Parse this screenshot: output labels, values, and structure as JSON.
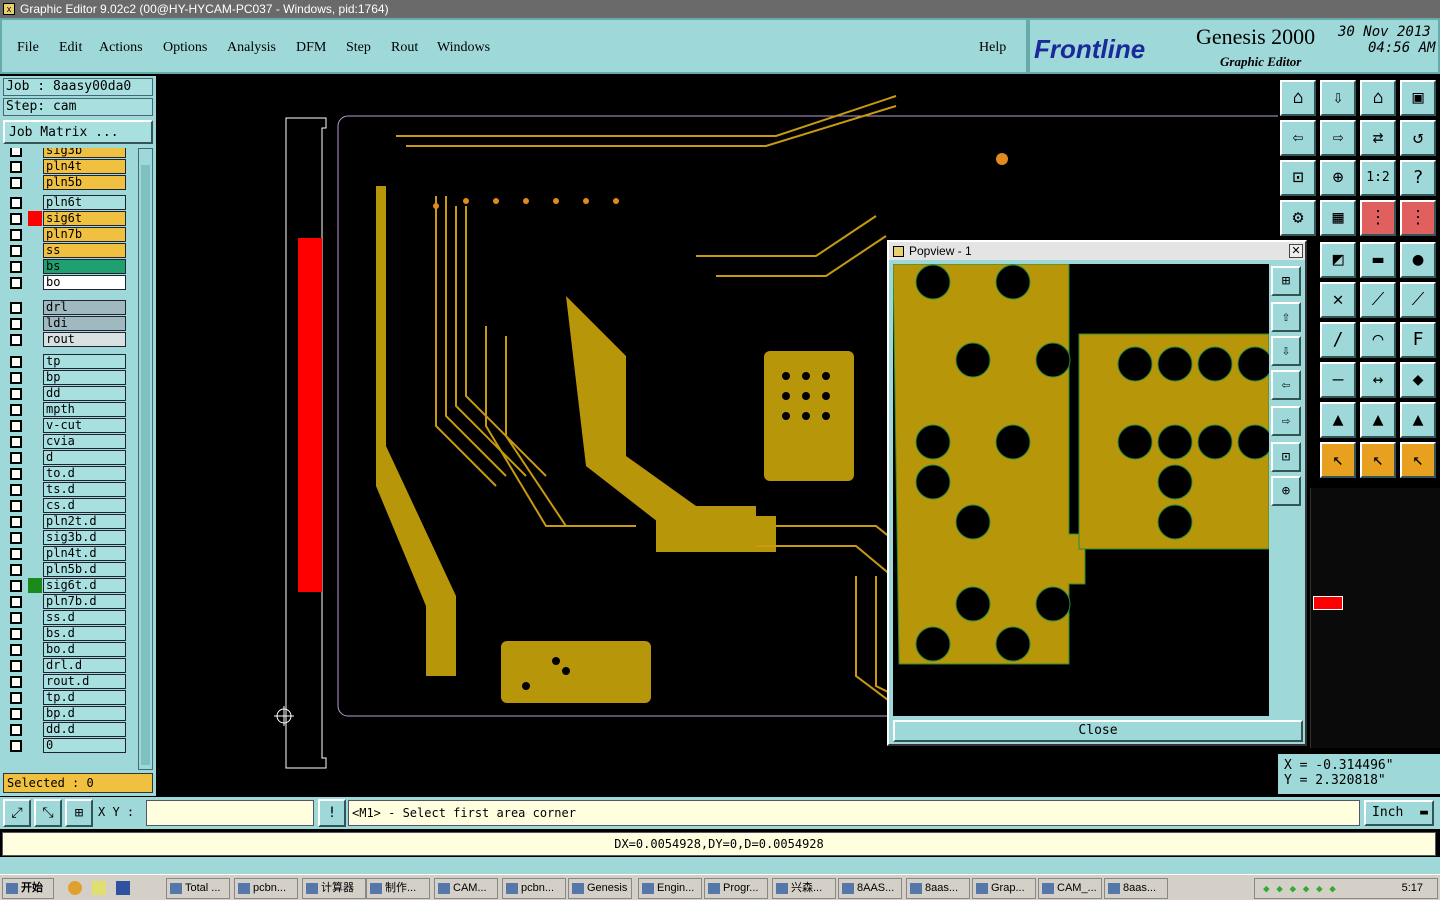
{
  "window": {
    "title": "Graphic Editor 9.02c2 (00@HY-HYCAM-PC037 - Windows, pid:1764)"
  },
  "menu": {
    "items": [
      "File",
      "Edit",
      "Actions",
      "Options",
      "Analysis",
      "DFM",
      "Step",
      "Rout",
      "Windows"
    ],
    "help": "Help"
  },
  "brand": {
    "logo": "Frontline",
    "product": "Genesis 2000",
    "subtitle": "Graphic Editor",
    "date": "30 Nov 2013",
    "time": "04:56 AM"
  },
  "job": {
    "job_label": "Job : 8aasy00da0",
    "step_label": "Step: cam",
    "matrix_button": "Job Matrix ..."
  },
  "layers": [
    {
      "name": "sig3b",
      "bg": "#f0c040",
      "color": ""
    },
    {
      "name": "pln4t",
      "bg": "#f0c040",
      "color": ""
    },
    {
      "name": "pln5b",
      "bg": "#f0c040",
      "color": ""
    },
    {
      "name": "pln6t",
      "bg": "#a8e0e0",
      "color": ""
    },
    {
      "name": "sig6t",
      "bg": "#f0c040",
      "color": "#ff0000"
    },
    {
      "name": "pln7b",
      "bg": "#f0c040",
      "color": ""
    },
    {
      "name": "ss",
      "bg": "#f0c040",
      "color": ""
    },
    {
      "name": "bs",
      "bg": "#20a070",
      "color": ""
    },
    {
      "name": "bo",
      "bg": "#ffffff",
      "color": ""
    },
    {
      "name": "drl",
      "bg": "#a0b8c0",
      "color": ""
    },
    {
      "name": "ldi",
      "bg": "#a0b8c0",
      "color": ""
    },
    {
      "name": "rout",
      "bg": "#d8e0e0",
      "color": ""
    },
    {
      "name": "tp",
      "bg": "#a8e0e0",
      "color": ""
    },
    {
      "name": "bp",
      "bg": "#a8e0e0",
      "color": ""
    },
    {
      "name": "dd",
      "bg": "#a8e0e0",
      "color": ""
    },
    {
      "name": "mpth",
      "bg": "#a8e0e0",
      "color": ""
    },
    {
      "name": "v-cut",
      "bg": "#a8e0e0",
      "color": ""
    },
    {
      "name": "cvia",
      "bg": "#a8e0e0",
      "color": ""
    },
    {
      "name": "d",
      "bg": "#a8e0e0",
      "color": ""
    },
    {
      "name": "to.d",
      "bg": "#a8e0e0",
      "color": ""
    },
    {
      "name": "ts.d",
      "bg": "#a8e0e0",
      "color": ""
    },
    {
      "name": "cs.d",
      "bg": "#a8e0e0",
      "color": ""
    },
    {
      "name": "pln2t.d",
      "bg": "#a8e0e0",
      "color": ""
    },
    {
      "name": "sig3b.d",
      "bg": "#a8e0e0",
      "color": ""
    },
    {
      "name": "pln4t.d",
      "bg": "#a8e0e0",
      "color": ""
    },
    {
      "name": "pln5b.d",
      "bg": "#a8e0e0",
      "color": ""
    },
    {
      "name": "sig6t.d",
      "bg": "#a8e0e0",
      "color": "#1a8a1a"
    },
    {
      "name": "pln7b.d",
      "bg": "#a8e0e0",
      "color": ""
    },
    {
      "name": "ss.d",
      "bg": "#a8e0e0",
      "color": ""
    },
    {
      "name": "bs.d",
      "bg": "#a8e0e0",
      "color": ""
    },
    {
      "name": "bo.d",
      "bg": "#a8e0e0",
      "color": ""
    },
    {
      "name": "drl.d",
      "bg": "#a8e0e0",
      "color": ""
    },
    {
      "name": "rout.d",
      "bg": "#a8e0e0",
      "color": ""
    },
    {
      "name": "tp.d",
      "bg": "#a8e0e0",
      "color": ""
    },
    {
      "name": "bp.d",
      "bg": "#a8e0e0",
      "color": ""
    },
    {
      "name": "dd.d",
      "bg": "#a8e0e0",
      "color": ""
    },
    {
      "name": "0",
      "bg": "#a8e0e0",
      "color": ""
    }
  ],
  "selected": "Selected : 0",
  "popview": {
    "title": "Popview - 1",
    "close": "Close"
  },
  "coords": {
    "x": "X = -0.314496\"",
    "y": "Y = 2.320818\""
  },
  "status": {
    "xy_label": "X Y :",
    "xy_value": "",
    "prompt": "<M1> - Select first area corner",
    "units": "Inch"
  },
  "measure": "DX=0.0054928,DY=0,D=0.0054928",
  "taskbar": {
    "start": "开始",
    "clock": "5:17",
    "tasks": [
      "Total ...",
      "pcbn...",
      "计算器",
      "制作...",
      "CAM...",
      "pcbn...",
      "Genesis",
      "Engin...",
      "Progr...",
      "兴森...",
      "8AAS...",
      "8aas...",
      "Grap...",
      "CAM_...",
      "8aas..."
    ]
  }
}
